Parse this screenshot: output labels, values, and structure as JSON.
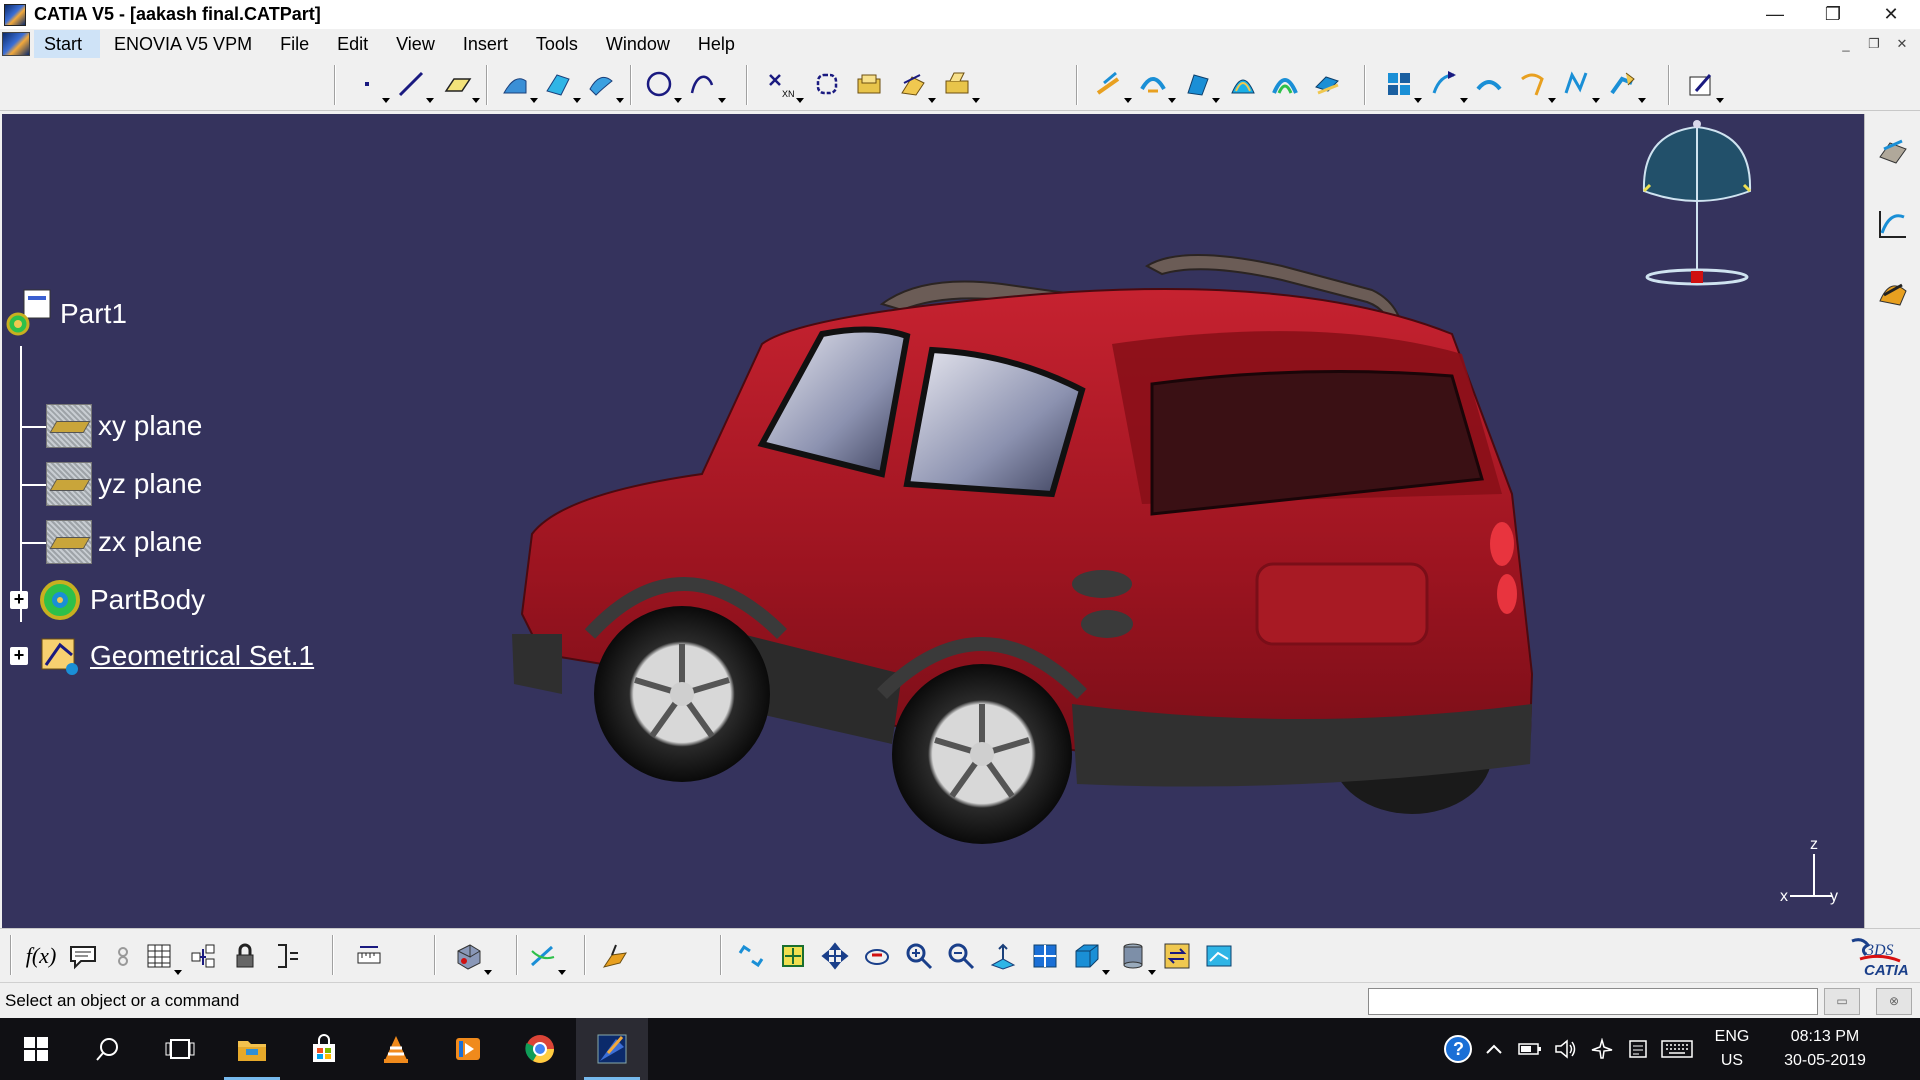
{
  "window": {
    "title": "CATIA V5 - [aakash final.CATPart]",
    "minimize": "—",
    "restore": "❐",
    "close": "✕"
  },
  "menu": {
    "items": [
      "Start",
      "ENOVIA V5 VPM",
      "File",
      "Edit",
      "View",
      "Insert",
      "Tools",
      "Window",
      "Help"
    ],
    "doc_minimize": "_",
    "doc_restore": "❐",
    "doc_close": "✕"
  },
  "tree": {
    "root": "Part1",
    "nodes": [
      "xy plane",
      "yz plane",
      "zx plane",
      "PartBody",
      "Geometrical Set.1"
    ],
    "expanders": [
      "+",
      "+"
    ]
  },
  "axis": {
    "x": "x",
    "y": "y",
    "z": "z"
  },
  "status": {
    "message": "Select an object or a command",
    "command_value": ""
  },
  "formula_label": "f(x)",
  "catia_logo": {
    "brand": "CATIA",
    "mark": "3DS"
  },
  "taskbar": {
    "apps": [
      "Start",
      "Search",
      "Task View",
      "File Explorer",
      "Store",
      "VLC",
      "Media Player",
      "Chrome",
      "CATIA V5"
    ],
    "language": {
      "line1": "ENG",
      "line2": "US"
    },
    "clock": {
      "time": "08:13 PM",
      "date": "30-05-2019"
    }
  },
  "colors": {
    "viewport_bg": "#35335d",
    "car_body": "#b21a24",
    "selection_blue": "#cfe3f7",
    "taskbar": "#101014"
  },
  "icons": {
    "top_toolbar": [
      "point-icon",
      "line-icon",
      "plane-icon",
      "extrude-surface-icon",
      "revolve-surface-icon",
      "sweep-icon",
      "circle-icon",
      "spline-icon",
      "intersection-icon",
      "boundary-icon",
      "join-icon",
      "split-icon",
      "trim-icon",
      "extract-icon",
      "fillet-icon",
      "sweep-surface-icon",
      "offset-icon",
      "fill-icon",
      "multi-section-icon",
      "blend-icon",
      "translate-icon",
      "axis-system-icon",
      "project-icon",
      "scaling-icon",
      "affinity-icon",
      "sketcher-icon"
    ],
    "bottom_toolbar": [
      "formula-icon",
      "comment-icon",
      "constraint-icon",
      "table-icon",
      "knowledge-icon",
      "lock-icon",
      "parameter-icon",
      "measure-icon",
      "material-icon",
      "apply-material-icon",
      "fly-icon",
      "fit-all-icon",
      "pan-icon",
      "rotate-icon",
      "zoom-in-icon",
      "zoom-out-icon",
      "normal-view-icon",
      "multi-view-icon",
      "iso-view-icon",
      "shading-icon",
      "hide-show-icon",
      "swap-visible-space-icon"
    ],
    "right_bar": [
      "sketch-tools-icon",
      "law-icon",
      "generative-shape-icon"
    ]
  }
}
